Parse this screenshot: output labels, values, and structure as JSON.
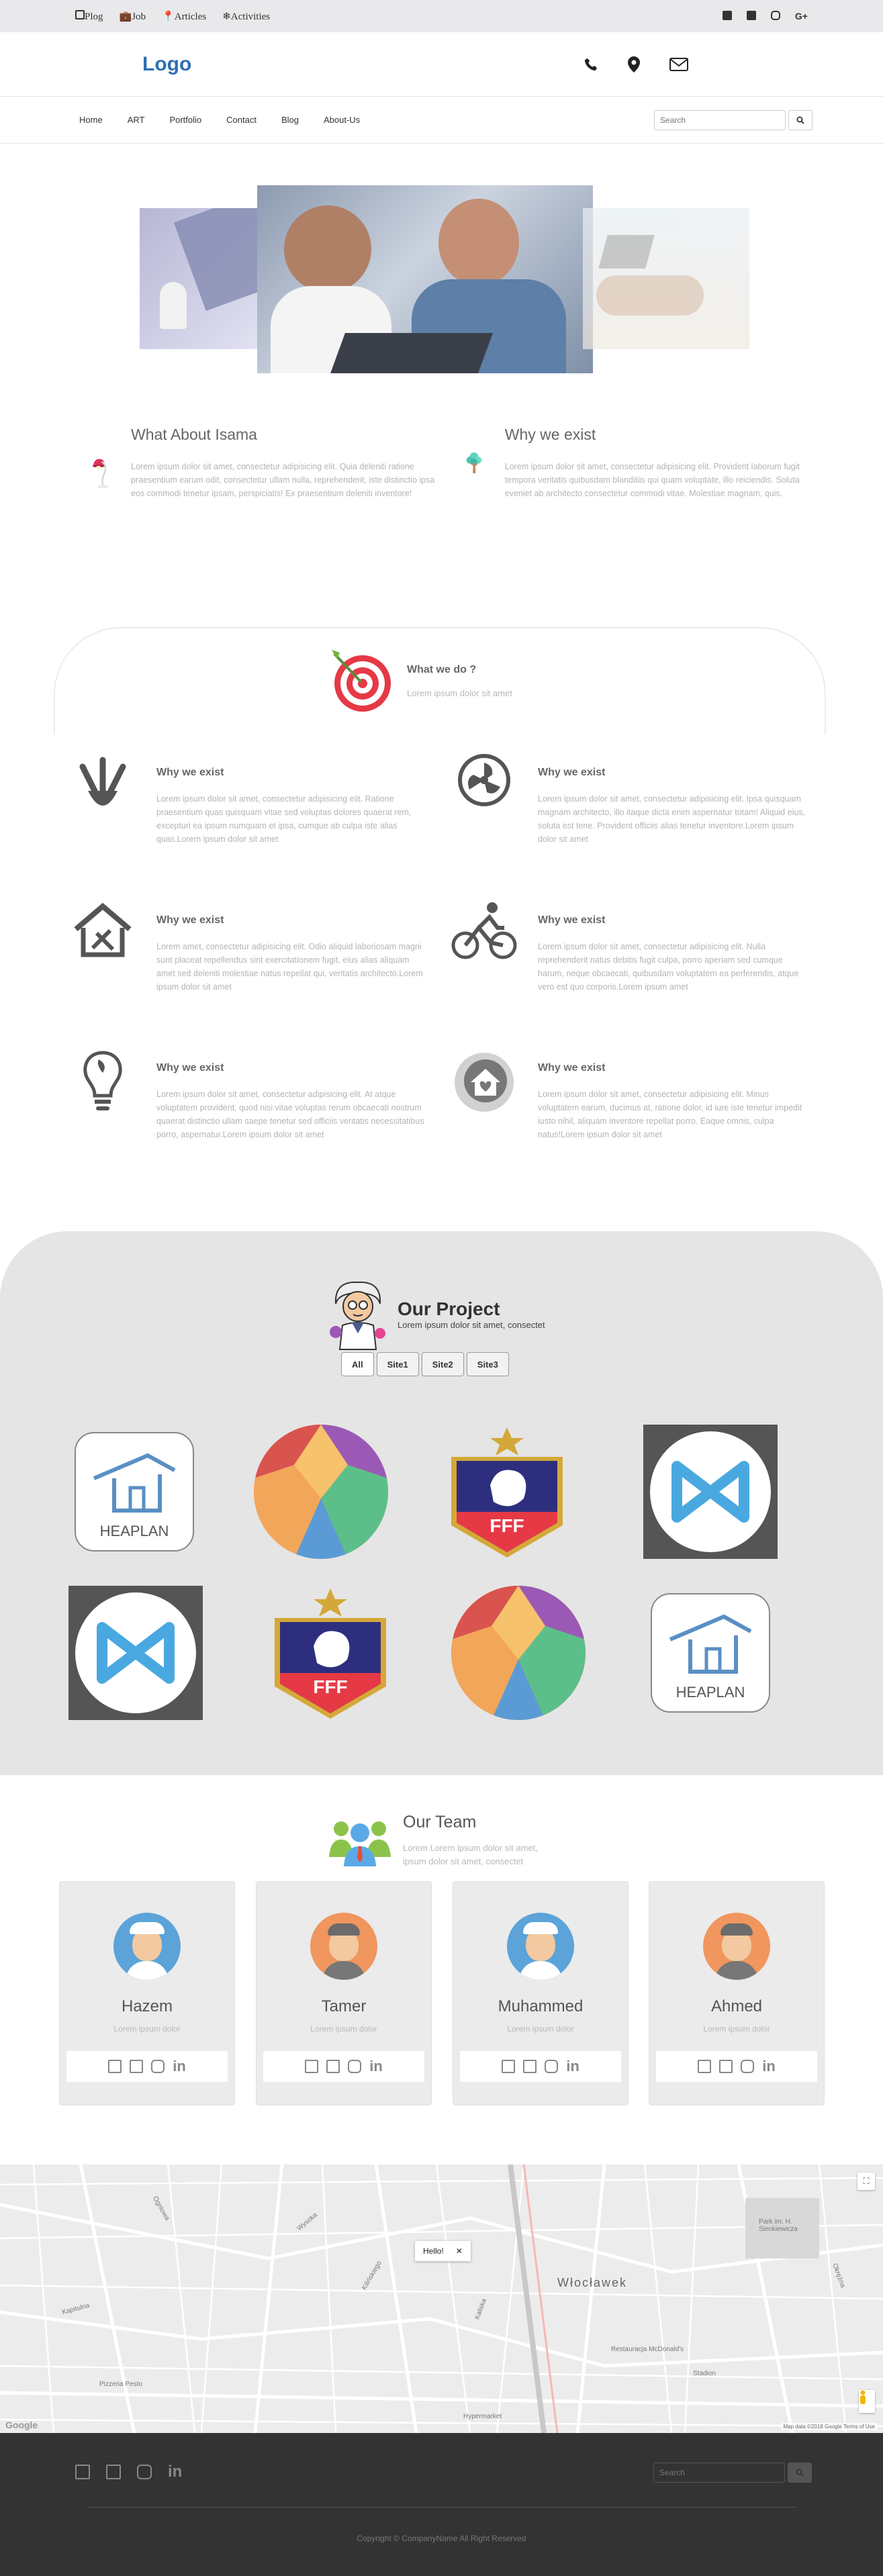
{
  "topbar": {
    "links": [
      {
        "label": "Plog",
        "icon": "square-icon"
      },
      {
        "label": "Job",
        "icon": "briefcase-icon"
      },
      {
        "label": "Articles",
        "icon": "pin-icon"
      },
      {
        "label": "Activities",
        "icon": "snowflake-icon"
      }
    ],
    "social": [
      "facebook-icon",
      "twitter-icon",
      "instagram-icon",
      "google-plus-icon"
    ],
    "gplus_label": "G+"
  },
  "header": {
    "logo": "Logo"
  },
  "nav": {
    "items": [
      "Home",
      "ART",
      "Portfolio",
      "Contact",
      "Blog",
      "About-Us"
    ],
    "search_placeholder": "Search"
  },
  "about": [
    {
      "title": "What About Isama",
      "text": "Lorem ipsum dolor sit amet, consectetur adipisicing elit. Quia deleniti ratione praesentium earum odit, consectetur ullam nulla, reprehenderit, iste distinctio ipsa eos commodi tenetur ipsam, perspiciatis! Ex praesentium deleniti inventore!",
      "icon": "desk-lamp-icon"
    },
    {
      "title": "Why we exist",
      "text": "Lorem ipsum dolor sit amet, consectetur adipisicing elit. Provident laborum fugit tempora veritatis quibusdam blanditiis qui quam voluptate, illo reiciendis. Soluta eveniet ab architecto consectetur commodi vitae. Molestiae magnam, quis.",
      "icon": "tree-icon"
    }
  ],
  "services": {
    "title": "What we do ?",
    "subtitle": "Lorem ipsum dolor sit amet",
    "items": [
      {
        "title": "Why we exist",
        "text": "Lorem ipsum dolor sit amet, consectetur adipisicing elit. Ratione praesentium quas quisquam vitae sed voluptas dolores quaerat rem, excepturi ea ipsum numquam et ipsa, cumque ab culpa iste alias quas.Lorem ipsum dolor sit amet",
        "icon": "tools-icon"
      },
      {
        "title": "Why we exist",
        "text": "Lorem ipsum dolor sit amet, consectetur adipisicing elit. Ipsa quisquam magnam architecto, illo itaque dicta enim aspernatur totam! Aliquid eius, soluta est tene. Provident officiis alias tenetur inventore.Lorem ipsum dolor sit amet",
        "icon": "fan-icon"
      },
      {
        "title": "Why we exist",
        "text": "Lorem amet, consectetur adipisicing elit. Odio aliquid laboriosam magni sunt placeat repellendus sint exercitationem fugit, eius alias aliquam amet sed deleniti molestiae natus repellat qui, veritatis architecto.Lorem ipsum dolor sit amet",
        "icon": "house-tools-icon"
      },
      {
        "title": "Why we exist",
        "text": "Lorem ipsum dolor sit amet, consectetur adipisicing elit. Nulla reprehenderit natus debitis fugit culpa, porro aperiam sed cumque harum, neque obcaecati, quibusdam voluptatem ea perferendis, atque vero est quo corporis.Lorem ipsum amet",
        "icon": "cyclist-icon"
      },
      {
        "title": "Why we exist",
        "text": "Lorem ipsum dolor sit amet, consectetur adipisicing elit. At atque voluptatem provident, quod nisi vitae voluptas rerum obcaecati nostrum quaerat distinctio ullam saepe tenetur sed officiis veritatis necessitatibus porro, aspernatur.Lorem ipsum dolor sit amet",
        "icon": "lightbulb-leaf-icon"
      },
      {
        "title": "Why we exist",
        "text": "Lorem ipsum dolor sit amet, consectetur adipisicing elit. Minus voluptatem earum, ducimus at, ratione dolor, id iure iste tenetur impedit iusto nihil, aliquam inventore repellat porro. Eaque omnis, culpa natus!Lorem ipsum dolor sit amet",
        "icon": "heart-house-icon"
      }
    ]
  },
  "project": {
    "title": "Our Project",
    "subtitle": "Lorem ipsum dolor sit amet, consectet",
    "filters": [
      "All",
      "Site1",
      "Site2",
      "Site3"
    ],
    "thumbs": [
      "heaplan-logo",
      "polygon-circle-logo",
      "fff-crest-logo",
      "blue-x-logo",
      "blue-x-logo",
      "fff-crest-logo",
      "polygon-circle-logo",
      "heaplan-logo"
    ],
    "heaplan_text": "HEAPLAN",
    "fff_text": "FFF"
  },
  "team": {
    "title": "Our Team",
    "subtitle": "Lorem Lorem ipsum dolor sit amet, ipsum dolor sit amet, consectet",
    "members": [
      {
        "name": "Hazem",
        "role": "Lorem ipsum dolor",
        "color": "#5ba3d9"
      },
      {
        "name": "Tamer",
        "role": "Lorem ipsum dolor",
        "color": "#f0965e"
      },
      {
        "name": "Muhammed",
        "role": "Lorem ipsum dolor",
        "color": "#5ba3d9"
      },
      {
        "name": "Ahmed",
        "role": "Lorem ipsum dolor",
        "color": "#f0965e"
      }
    ],
    "social_in": "in"
  },
  "map": {
    "popup": "Hello!",
    "city": "Włocławek",
    "labels": [
      "Pizzeria Pesto",
      "Restauracja McDonald's",
      "Hypermarket",
      "Stadion",
      "Park im. H. Sienkiewicza",
      "Kapitulna",
      "Kilińskiego",
      "Kaliska",
      "Wysoka",
      "Okrężna",
      "Ogniowa"
    ],
    "footer": "Map data ©2018 Google   Terms of Use",
    "google": "Google"
  },
  "footer": {
    "search_placeholder": "Search",
    "copyright": "Copyright © CompanyName All Right Reserved",
    "social_in": "in"
  }
}
